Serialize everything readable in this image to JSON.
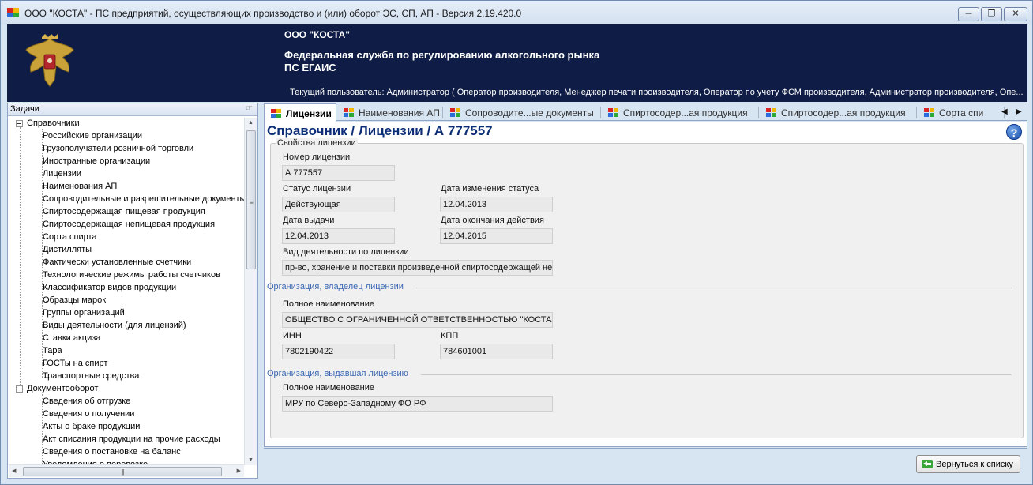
{
  "window": {
    "title": "ООО \"КОСТА\" - ПС предприятий, осуществляющих производство и (или) оборот ЭС, СП, АП - Версия 2.19.420.0"
  },
  "banner": {
    "org": "ООО \"КОСТА\"",
    "service": "Федеральная служба по регулированию алкогольного рынка",
    "system": "ПС ЕГАИС",
    "user": "Текущий пользователь: Администратор ( Оператор производителя, Менеджер печати производителя, Оператор по учету ФСМ производителя, Администратор производителя, Опе..."
  },
  "tasks": {
    "title": "Задачи",
    "groups": [
      {
        "label": "Справочники",
        "items": [
          "Российские организации",
          "Грузополучатели розничной торговли",
          "Иностранные организации",
          "Лицензии",
          "Наименования АП",
          "Сопроводительные и разрешительные документы",
          "Спиртосодержащая пищевая продукция",
          "Спиртосодержащая непищевая продукция",
          "Сорта спирта",
          "Дистилляты",
          "Фактически установленные счетчики",
          "Технологические режимы работы счетчиков",
          "Классификатор видов продукции",
          "Образцы марок",
          "Группы организаций",
          "Виды деятельности (для лицензий)",
          "Ставки акциза",
          "Тара",
          "ГОСТы на спирт",
          "Транспортные средства"
        ]
      },
      {
        "label": "Документооборот",
        "items": [
          "Сведения об отгрузке",
          "Сведения о получении",
          "Акты о браке продукции",
          "Акт списания продукции на прочие расходы",
          "Сведения о постановке на баланс",
          "Уведомления о перевозке"
        ]
      }
    ]
  },
  "tabs": [
    {
      "label": "Лицензии",
      "active": true
    },
    {
      "label": "Наименования АП",
      "active": false
    },
    {
      "label": "Сопроводите...ые документы",
      "active": false
    },
    {
      "label": "Спиртосодер...ая продукция",
      "active": false
    },
    {
      "label": "Спиртосодер...ая продукция",
      "active": false
    },
    {
      "label": "Сорта спи",
      "active": false
    }
  ],
  "page": {
    "title": "Справочник / Лицензии / А 777557",
    "group_legend": "Свойства лицензии",
    "license_number_label": "Номер лицензии",
    "license_number": "А 777557",
    "status_label": "Статус лицензии",
    "status": "Действующая",
    "status_change_label": "Дата изменения статуса",
    "status_change": "12.04.2013",
    "issue_label": "Дата выдачи",
    "issue": "12.04.2013",
    "expiry_label": "Дата окончания действия",
    "expiry": "12.04.2015",
    "activity_label": "Вид деятельности по лицензии",
    "activity": "пр-во, хранение и поставки произведенной спиртосодержащей не",
    "owner_section": "Организация, владелец лицензии",
    "owner_name_label": "Полное наименование",
    "owner_name": "ОБЩЕСТВО С ОГРАНИЧЕННОЙ ОТВЕТСТВЕННОСТЬЮ \"КОСТА\"",
    "inn_label": "ИНН",
    "inn": "7802190422",
    "kpp_label": "КПП",
    "kpp": "784601001",
    "issuer_section": "Организация, выдавшая лицензию",
    "issuer_name_label": "Полное наименование",
    "issuer_name": "МРУ по Северо-Западному ФО РФ"
  },
  "actions": {
    "back_label": "Вернуться к списку"
  },
  "colors": {
    "banner": "#0f1d46",
    "title": "#0c2e77",
    "section": "#3a67b3"
  }
}
